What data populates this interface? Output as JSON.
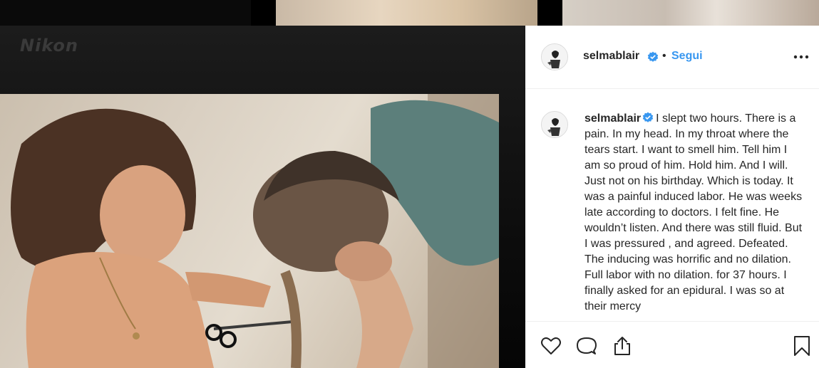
{
  "camera_brand": "Nikon",
  "post": {
    "username": "selmablair",
    "follow_label": "Segui",
    "separator": "•",
    "caption": "I slept two hours. There is a pain. In my head. In my throat where the tears start. I want to smell him. Tell him I am so proud of him. Hold him. And I will. Just not on his birthday. Which is today. It was a painful induced labor. He was weeks late according to doctors. I felt fine. He wouldn’t listen. And there was still fluid. But I was pressured , and agreed. Defeated. The inducing was horrific and no dilation. Full labor with no dilation. for 37 hours. I finally asked for an epidural. I was so at their mercy"
  },
  "icons": {
    "verified": "verified-badge-icon",
    "more": "more-options-icon",
    "like": "heart-icon",
    "comment": "comment-icon",
    "share": "share-icon",
    "save": "bookmark-icon"
  },
  "colors": {
    "link": "#3897f0",
    "verified": "#3897f0",
    "text": "#262626",
    "border": "#efefef"
  }
}
